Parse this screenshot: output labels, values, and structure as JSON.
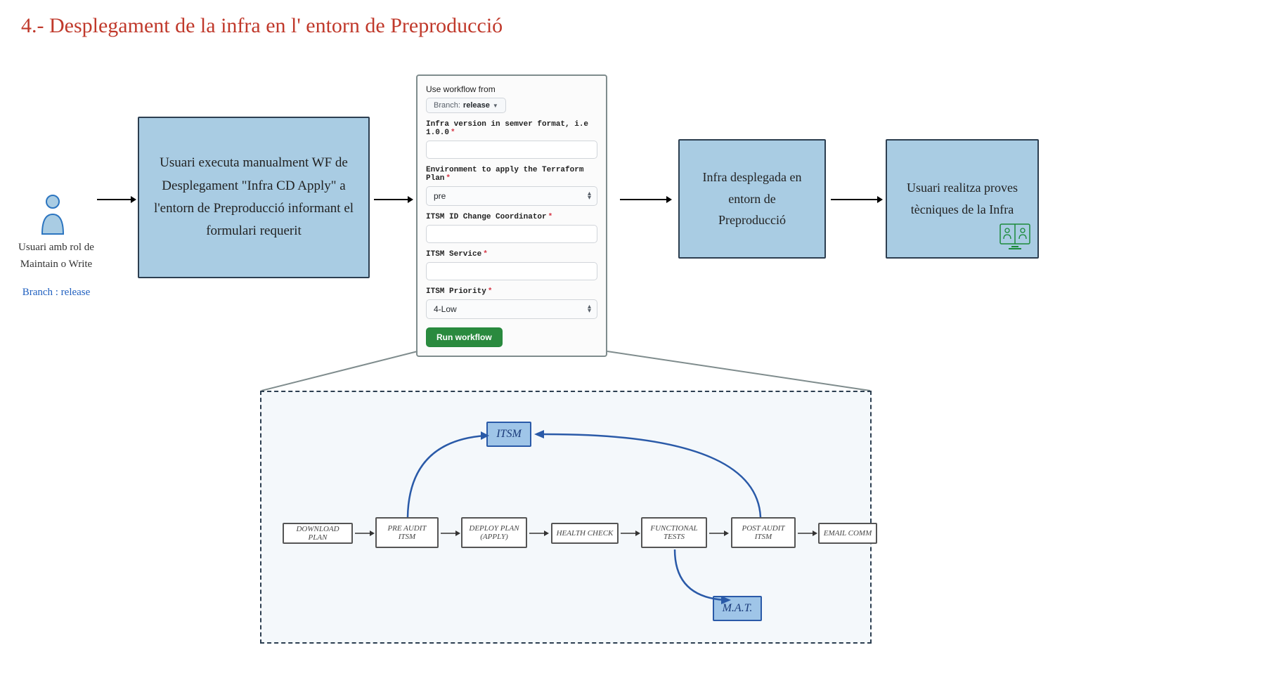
{
  "title": "4.- Desplegament de la infra en l' entorn de Preproducció",
  "user": {
    "label": "Usuari amb rol de Maintain o Write",
    "branch": "Branch : release"
  },
  "sticky1": "Usuari executa manualment WF de Desplegament \"Infra CD Apply\" a l'entorn de Preproducció informant el formulari requerit",
  "sticky2": "Infra desplegada en entorn de Preproducció",
  "sticky3": "Usuari realitza proves tècniques de la Infra",
  "form": {
    "use_workflow_label": "Use workflow from",
    "branch_prefix": "Branch:",
    "branch_value": "release",
    "infra_version_label": "Infra version in semver format, i.e 1.0.0",
    "infra_version_value": "",
    "env_label": "Environment to apply the Terraform Plan",
    "env_value": "pre",
    "itsm_id_label": "ITSM ID Change Coordinator",
    "itsm_id_value": "",
    "itsm_service_label": "ITSM Service",
    "itsm_service_value": "",
    "itsm_priority_label": "ITSM Priority",
    "itsm_priority_value": "4-Low",
    "run_button": "Run workflow"
  },
  "pipeline": {
    "itsm": "ITSM",
    "mat": "M.A.T.",
    "steps": [
      "DOWNLOAD PLAN",
      "PRE AUDIT ITSM",
      "DEPLOY PLAN (APPLY)",
      "HEALTH CHECK",
      "FUNCTIONAL TESTS",
      "POST AUDIT ITSM",
      "EMAIL COMM"
    ]
  }
}
